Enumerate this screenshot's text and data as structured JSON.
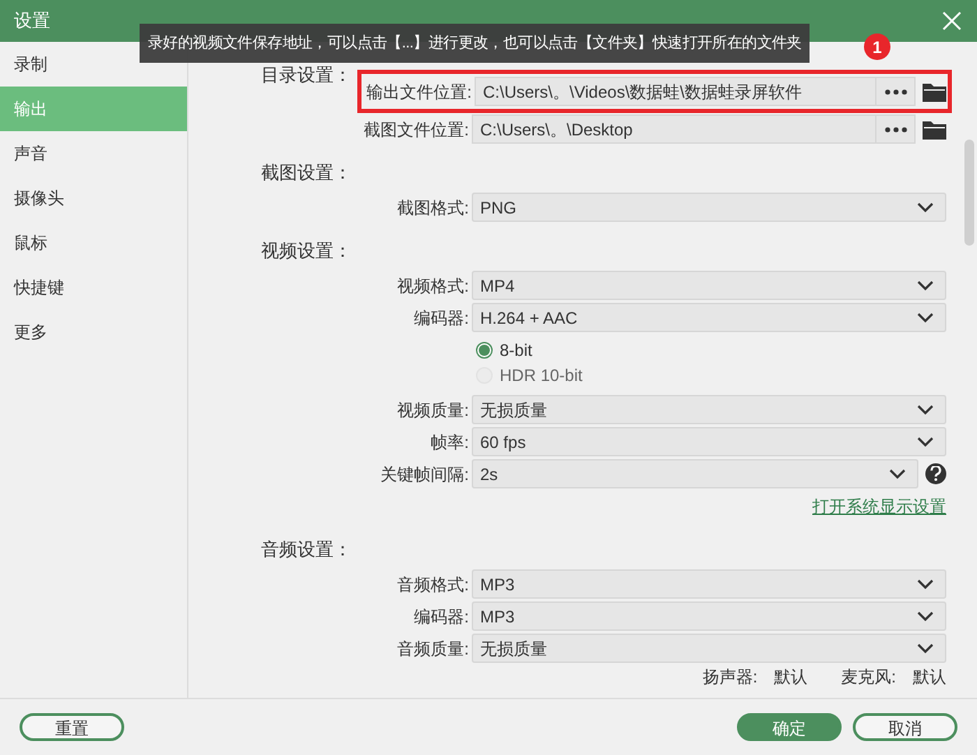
{
  "window": {
    "title": "设置"
  },
  "sidebar": {
    "items": [
      {
        "label": "录制",
        "selected": false
      },
      {
        "label": "输出",
        "selected": true
      },
      {
        "label": "声音",
        "selected": false
      },
      {
        "label": "摄像头",
        "selected": false
      },
      {
        "label": "鼠标",
        "selected": false
      },
      {
        "label": "快捷键",
        "selected": false
      },
      {
        "label": "更多",
        "selected": false
      }
    ]
  },
  "tooltip": {
    "text": "录好的视频文件保存地址，可以点击【...】进行更改，也可以点击【文件夹】快速打开所在的文件夹",
    "badge": "1"
  },
  "sections": [
    {
      "heading": "目录设置：",
      "rows": [
        {
          "kind": "path",
          "label": "输出文件位置:",
          "value": "C:\\Users\\。\\Videos\\数据蛙\\数据蛙录屏软件",
          "highlighted": true
        },
        {
          "kind": "path",
          "label": "截图文件位置:",
          "value": "C:\\Users\\。\\Desktop",
          "highlighted": false
        }
      ]
    },
    {
      "heading": "截图设置：",
      "rows": [
        {
          "kind": "select",
          "label": "截图格式:",
          "value": "PNG"
        }
      ]
    },
    {
      "heading": "视频设置：",
      "rows": [
        {
          "kind": "select",
          "label": "视频格式:",
          "value": "MP4"
        },
        {
          "kind": "select",
          "label": "编码器:",
          "value": "H.264 + AAC"
        },
        {
          "kind": "radio",
          "label": "8-bit",
          "selected": true
        },
        {
          "kind": "radio",
          "label": "HDR 10-bit",
          "selected": false
        },
        {
          "kind": "select",
          "label": "视频质量:",
          "value": "无损质量"
        },
        {
          "kind": "select",
          "label": "帧率:",
          "value": "60 fps"
        },
        {
          "kind": "select_help",
          "label": "关键帧间隔:",
          "value": "2s"
        },
        {
          "kind": "link",
          "label": "打开系统显示设置"
        }
      ]
    },
    {
      "heading": "音频设置：",
      "rows": [
        {
          "kind": "select",
          "label": "音频格式:",
          "value": "MP3"
        },
        {
          "kind": "select",
          "label": "编码器:",
          "value": "MP3"
        },
        {
          "kind": "select",
          "label": "音频质量:",
          "value": "无损质量"
        },
        {
          "kind": "devices",
          "items": [
            {
              "label": "扬声器:",
              "value": "默认"
            },
            {
              "label": "麦克风:",
              "value": "默认"
            }
          ]
        }
      ]
    }
  ],
  "buttons": [
    {
      "label": "重置",
      "kind": "outline"
    },
    {
      "label": "确定",
      "kind": "primary"
    },
    {
      "label": "取消",
      "kind": "outline"
    }
  ]
}
